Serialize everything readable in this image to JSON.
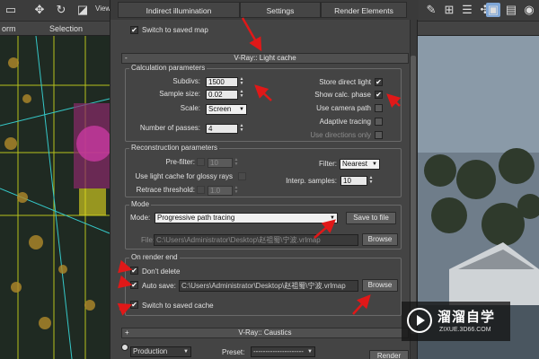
{
  "background": {
    "toolbar_label_view": "View",
    "menu_left": "orm",
    "menu_selection": "Selection"
  },
  "tabs": [
    "Indirect illumination",
    "Settings",
    "Render Elements"
  ],
  "top_checkbox": {
    "label": "Switch to saved map",
    "checked": true
  },
  "rollout": {
    "title": "V-Ray:: Light cache",
    "toggle": "-"
  },
  "calc": {
    "title": "Calculation parameters",
    "subdivs_label": "Subdivs:",
    "subdivs": "1500",
    "sample_size_label": "Sample size:",
    "sample_size": "0.02",
    "scale_label": "Scale:",
    "scale": "Screen",
    "passes_label": "Number of passes:",
    "passes": "4",
    "store_direct_light": {
      "label": "Store direct light",
      "checked": true
    },
    "show_calc_phase": {
      "label": "Show calc. phase",
      "checked": true
    },
    "use_camera_path": {
      "label": "Use camera path",
      "checked": false
    },
    "adaptive_tracing": {
      "label": "Adaptive tracing",
      "checked": false
    },
    "use_directions_only": {
      "label": "Use directions only",
      "checked": false
    }
  },
  "recon": {
    "title": "Reconstruction parameters",
    "prefilter_label": "Pre-filter:",
    "prefilter": "10",
    "glossy_label": "Use light cache for glossy rays",
    "retrace_label": "Retrace threshold:",
    "retrace": "1.0",
    "filter_label": "Filter:",
    "filter": "Nearest",
    "interp_label": "Interp. samples:",
    "interp": "10"
  },
  "mode": {
    "title": "Mode",
    "mode_label": "Mode:",
    "mode_value": "Progressive path tracing",
    "save_btn": "Save to file",
    "file_label": "File:",
    "file_path": "C:\\Users\\Administrator\\Desktop\\赵祖蜀\\宁波.vrlmap",
    "browse": "Browse"
  },
  "render_end": {
    "title": "On render end",
    "dont_delete": {
      "label": "Don't delete",
      "checked": true
    },
    "auto_save": {
      "label": "Auto save:",
      "checked": true
    },
    "auto_save_path": "C:\\Users\\Administrator\\Desktop\\赵祖蜀\\宁波.vrlmap",
    "browse": "Browse",
    "switch_saved": {
      "label": "Switch to saved cache",
      "checked": true
    }
  },
  "caustics": {
    "title": "V-Ray:: Caustics",
    "toggle": "+"
  },
  "bottom": {
    "production": "Production",
    "preset_label": "Preset:",
    "preset_value": "---------------------",
    "render_btn": "Render"
  },
  "watermark": {
    "brand": "溜溜自学",
    "url": "ZIXUE.3D66.COM"
  },
  "colors": {
    "arrow": "#e01818",
    "dialog_bg": "#444444",
    "accent": "#7fa6d6"
  }
}
